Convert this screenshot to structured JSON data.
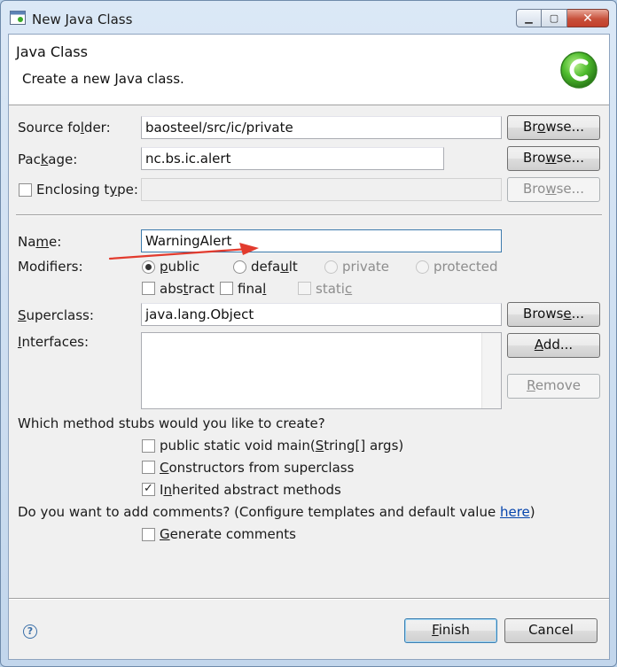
{
  "window": {
    "title": "New Java Class",
    "minimize_label": "▁",
    "maximize_label": "▢",
    "close_label": "✕"
  },
  "banner": {
    "title": "Java Class",
    "message": "Create a new Java class."
  },
  "source_folder": {
    "label_before": "Source fo",
    "label_u": "l",
    "label_after": "der:",
    "value": "baosteel/src/ic/private",
    "browse_before": "Br",
    "browse_u": "o",
    "browse_after": "wse..."
  },
  "package": {
    "label_before": "Pac",
    "label_u": "k",
    "label_after": "age:",
    "value": "nc.bs.ic.alert",
    "browse_before": "Bro",
    "browse_u": "w",
    "browse_after": "se..."
  },
  "enclosing_type": {
    "label_before": "Enclosing t",
    "label_u": "y",
    "label_after": "pe:",
    "checked": false,
    "value": "",
    "browse_before": "Bro",
    "browse_u": "w",
    "browse_after": "se..."
  },
  "name": {
    "label_before": "Na",
    "label_u": "m",
    "label_after": "e:",
    "value": "WarningAlert"
  },
  "modifiers": {
    "label": "Modifiers:",
    "public": {
      "before": "",
      "u": "p",
      "after": "ublic",
      "selected": true
    },
    "default": {
      "before": "defa",
      "u": "u",
      "after": "lt",
      "selected": false
    },
    "private": {
      "label": "private",
      "selected": false,
      "enabled": false
    },
    "protected": {
      "label": "protected",
      "selected": false,
      "enabled": false
    },
    "abstract": {
      "before": "abs",
      "u": "t",
      "after": "ract",
      "checked": false
    },
    "final": {
      "before": "fina",
      "u": "l",
      "after": "",
      "checked": false
    },
    "static": {
      "before": "stati",
      "u": "c",
      "after": "",
      "checked": false,
      "enabled": false
    }
  },
  "superclass": {
    "label_u": "S",
    "label_after": "uperclass:",
    "value": "java.lang.Object",
    "browse_before": "Brows",
    "browse_u": "e",
    "browse_after": "..."
  },
  "interfaces": {
    "label_u": "I",
    "label_after": "nterfaces:",
    "add_u": "A",
    "add_after": "dd...",
    "remove_u": "R",
    "remove_after": "emove"
  },
  "stubs": {
    "question": "Which method stubs would you like to create?",
    "main": {
      "before": "public static void main(",
      "u": "S",
      "after": "tring[] args)",
      "checked": false
    },
    "constructors": {
      "before": "",
      "u": "C",
      "after": "onstructors from superclass",
      "checked": false
    },
    "inherited": {
      "before": "I",
      "u": "n",
      "after": "herited abstract methods",
      "checked": true
    }
  },
  "comments": {
    "question": "Do you want to add comments? (Configure templates and default value ",
    "link": "here",
    "close_paren": ")",
    "generate": {
      "before": "",
      "u": "G",
      "after": "enerate comments",
      "checked": false
    }
  },
  "footer": {
    "help_label": "?",
    "finish_u": "F",
    "finish_after": "inish",
    "cancel_label": "Cancel"
  },
  "colors": {
    "arrow": "#e23b2e",
    "link": "#0645ad",
    "logo_green": "#3aa92a"
  }
}
